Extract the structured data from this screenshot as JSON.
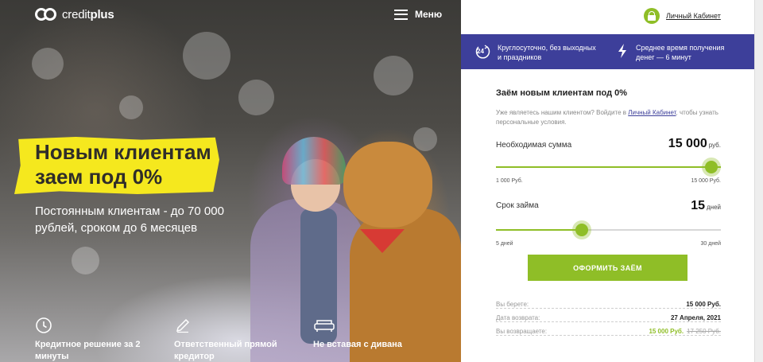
{
  "header": {
    "logo_text_regular": "credit",
    "logo_text_bold": "plus",
    "menu_label": "Меню"
  },
  "hero": {
    "promo_title": "Новым клиентам заем под 0%",
    "subtitle": "Постоянным клиентам - до 70 000 рублей, сроком до 6 месяцев",
    "features": [
      {
        "icon": "clock-icon",
        "label": "Кредитное решение за 2 минуты"
      },
      {
        "icon": "pencil-icon",
        "label": "Ответственный прямой кредитор"
      },
      {
        "icon": "sofa-icon",
        "label": "Не вставая с дивана"
      }
    ]
  },
  "panel": {
    "cabinet_link": "Личный Кабинет",
    "info": [
      {
        "icon": "24-hours-icon",
        "text": "Круглосуточно, без выходных и праздников"
      },
      {
        "icon": "lightning-icon",
        "text": "Среднее время получения денег — 6 минут"
      }
    ],
    "form": {
      "title": "Заём новым клиентам под 0%",
      "hint_prefix": "Уже являетесь нашим клиентом? Войдите в",
      "hint_link": "Личный Кабинет",
      "hint_suffix": ", чтобы узнать персональные условия.",
      "amount": {
        "label": "Необходимая сумма",
        "value": "15 000",
        "unit": "руб.",
        "min_label": "1 000 Руб.",
        "max_label": "15 000 Руб.",
        "fraction": 1.0
      },
      "term": {
        "label": "Срок займа",
        "value": "15",
        "unit": "дней",
        "min_label": "5 дней",
        "max_label": "30 дней",
        "fraction": 0.4
      },
      "submit_label": "ОФОРМИТЬ ЗАЁМ"
    },
    "summary": {
      "take_label": "Вы берете:",
      "take_value": "15 000 Руб.",
      "date_label": "Дата возврата:",
      "date_value": "27 Апреля, 2021",
      "return_label": "Вы возвращаете:",
      "return_value": "15 000 Руб.",
      "return_old": "17 250 Руб."
    }
  },
  "colors": {
    "accent_green": "#8fbe27",
    "brand_indigo": "#3d3f9a",
    "promo_yellow": "#f5e81e"
  }
}
